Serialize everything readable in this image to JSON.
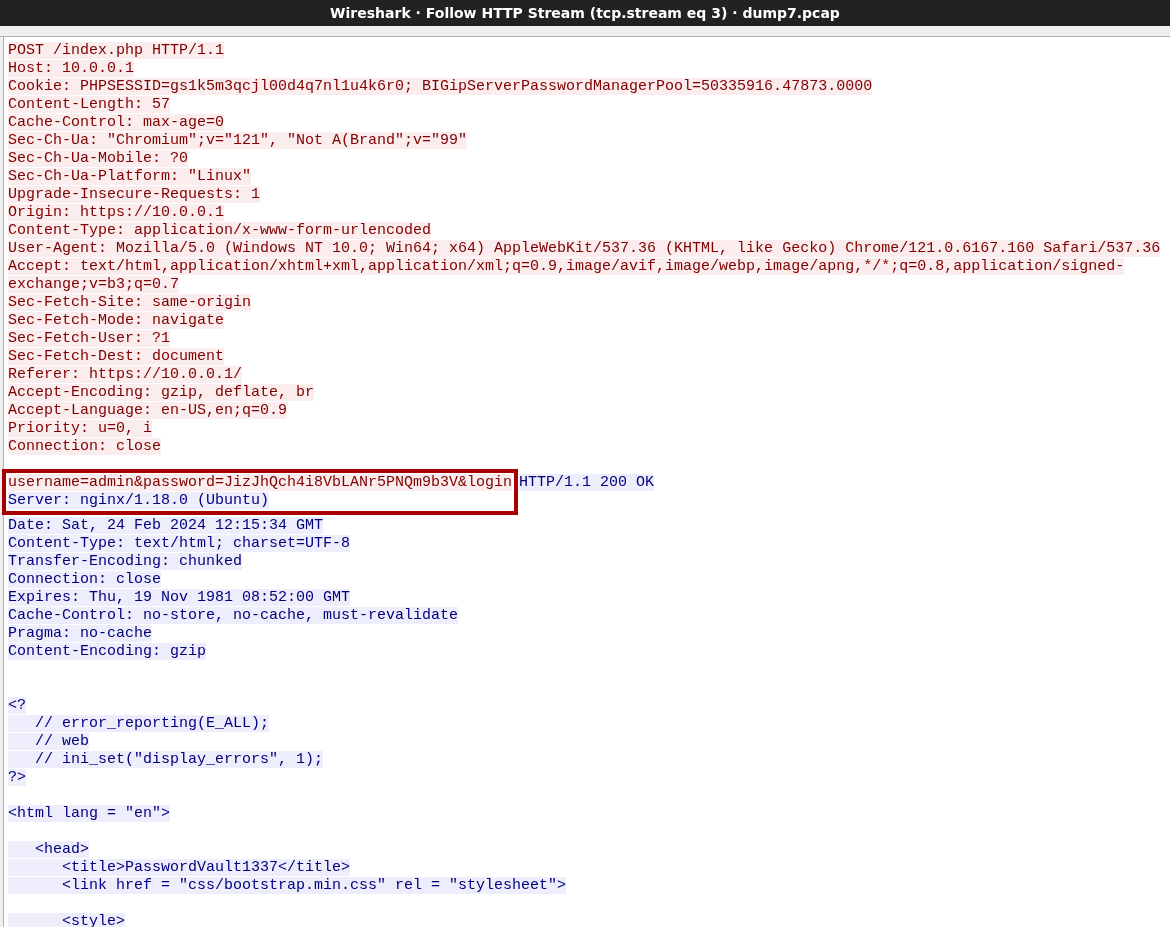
{
  "window": {
    "title": "Wireshark · Follow HTTP Stream (tcp.stream eq 3) · dump7.pcap"
  },
  "stream": {
    "lines": [
      {
        "kind": "client",
        "boxed": false,
        "text": "POST /index.php HTTP/1.1"
      },
      {
        "kind": "client",
        "boxed": false,
        "text": "Host: 10.0.0.1"
      },
      {
        "kind": "client",
        "boxed": false,
        "text": "Cookie: PHPSESSID=gs1k5m3qcjl00d4q7nl1u4k6r0; BIGipServerPasswordManagerPool=50335916.47873.0000"
      },
      {
        "kind": "client",
        "boxed": false,
        "text": "Content-Length: 57"
      },
      {
        "kind": "client",
        "boxed": false,
        "text": "Cache-Control: max-age=0"
      },
      {
        "kind": "client",
        "boxed": false,
        "text": "Sec-Ch-Ua: \"Chromium\";v=\"121\", \"Not A(Brand\";v=\"99\""
      },
      {
        "kind": "client",
        "boxed": false,
        "text": "Sec-Ch-Ua-Mobile: ?0"
      },
      {
        "kind": "client",
        "boxed": false,
        "text": "Sec-Ch-Ua-Platform: \"Linux\""
      },
      {
        "kind": "client",
        "boxed": false,
        "text": "Upgrade-Insecure-Requests: 1"
      },
      {
        "kind": "client",
        "boxed": false,
        "text": "Origin: https://10.0.0.1"
      },
      {
        "kind": "client",
        "boxed": false,
        "text": "Content-Type: application/x-www-form-urlencoded"
      },
      {
        "kind": "client",
        "boxed": false,
        "text": "User-Agent: Mozilla/5.0 (Windows NT 10.0; Win64; x64) AppleWebKit/537.36 (KHTML, like Gecko) Chrome/121.0.6167.160 Safari/537.36"
      },
      {
        "kind": "client",
        "boxed": false,
        "text": "Accept: text/html,application/xhtml+xml,application/xml;q=0.9,image/avif,image/webp,image/apng,*/*;q=0.8,application/signed-"
      },
      {
        "kind": "client",
        "boxed": false,
        "text": "exchange;v=b3;q=0.7"
      },
      {
        "kind": "client",
        "boxed": false,
        "text": "Sec-Fetch-Site: same-origin"
      },
      {
        "kind": "client",
        "boxed": false,
        "text": "Sec-Fetch-Mode: navigate"
      },
      {
        "kind": "client",
        "boxed": false,
        "text": "Sec-Fetch-User: ?1"
      },
      {
        "kind": "client",
        "boxed": false,
        "text": "Sec-Fetch-Dest: document"
      },
      {
        "kind": "client",
        "boxed": false,
        "text": "Referer: https://10.0.0.1/"
      },
      {
        "kind": "client",
        "boxed": false,
        "text": "Accept-Encoding: gzip, deflate, br"
      },
      {
        "kind": "client",
        "boxed": false,
        "text": "Accept-Language: en-US,en;q=0.9"
      },
      {
        "kind": "client",
        "boxed": false,
        "text": "Priority: u=0, i"
      },
      {
        "kind": "client",
        "boxed": false,
        "text": "Connection: close"
      },
      {
        "kind": "blank",
        "boxed": false
      },
      {
        "kind": "mixed",
        "boxed": true,
        "segments": [
          {
            "kind": "client",
            "text": "username=admin&password=JizJhQch4i8VbLANr5PNQm9b3V&login"
          },
          {
            "kind": "server",
            "text": "HTTP/1.1 200 OK"
          }
        ]
      },
      {
        "kind": "server",
        "boxed": true,
        "text": "Server: nginx/1.18.0 (Ubuntu)"
      },
      {
        "kind": "server",
        "boxed": false,
        "text": "Date: Sat, 24 Feb 2024 12:15:34 GMT"
      },
      {
        "kind": "server",
        "boxed": false,
        "text": "Content-Type: text/html; charset=UTF-8"
      },
      {
        "kind": "server",
        "boxed": false,
        "text": "Transfer-Encoding: chunked"
      },
      {
        "kind": "server",
        "boxed": false,
        "text": "Connection: close"
      },
      {
        "kind": "server",
        "boxed": false,
        "text": "Expires: Thu, 19 Nov 1981 08:52:00 GMT"
      },
      {
        "kind": "server",
        "boxed": false,
        "text": "Cache-Control: no-store, no-cache, must-revalidate"
      },
      {
        "kind": "server",
        "boxed": false,
        "text": "Pragma: no-cache"
      },
      {
        "kind": "server",
        "boxed": false,
        "text": "Content-Encoding: gzip"
      },
      {
        "kind": "blank",
        "boxed": false
      },
      {
        "kind": "blank",
        "boxed": false
      },
      {
        "kind": "server",
        "boxed": false,
        "text": "<?"
      },
      {
        "kind": "server",
        "boxed": false,
        "text": "   // error_reporting(E_ALL);"
      },
      {
        "kind": "server",
        "boxed": false,
        "text": "   // web"
      },
      {
        "kind": "server",
        "boxed": false,
        "text": "   // ini_set(\"display_errors\", 1);"
      },
      {
        "kind": "server",
        "boxed": false,
        "text": "?>"
      },
      {
        "kind": "blank",
        "boxed": false
      },
      {
        "kind": "server",
        "boxed": false,
        "text": "<html lang = \"en\">"
      },
      {
        "kind": "blank",
        "boxed": false
      },
      {
        "kind": "server",
        "boxed": false,
        "text": "   <head>"
      },
      {
        "kind": "server",
        "boxed": false,
        "text": "      <title>PasswordVault1337</title>"
      },
      {
        "kind": "server",
        "boxed": false,
        "text": "      <link href = \"css/bootstrap.min.css\" rel = \"stylesheet\">"
      },
      {
        "kind": "blank",
        "boxed": false
      },
      {
        "kind": "server",
        "boxed": false,
        "text": "      <style>"
      }
    ]
  }
}
